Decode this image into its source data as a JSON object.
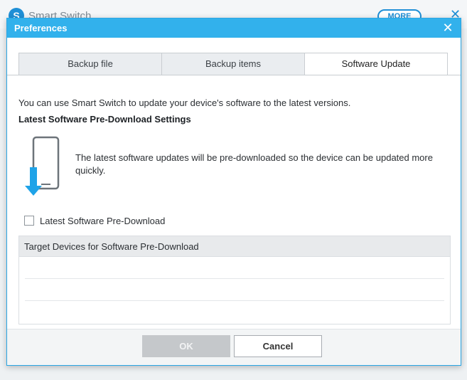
{
  "background_app": {
    "title": "Smart Switch",
    "more_label": "MORE",
    "close_glyph": "✕",
    "logo_glyph": "S"
  },
  "dialog": {
    "title": "Preferences",
    "close_glyph": "✕"
  },
  "tabs": [
    {
      "label": "Backup file",
      "active": false
    },
    {
      "label": "Backup items",
      "active": false
    },
    {
      "label": "Software Update",
      "active": true
    }
  ],
  "content": {
    "description": "You can use Smart Switch to update your device's software to the latest versions.",
    "section_heading": "Latest Software Pre-Download Settings",
    "info_text": "The latest software updates will be pre-downloaded so the device can be updated more quickly.",
    "checkbox": {
      "label": "Latest Software Pre-Download",
      "checked": false
    },
    "target_table": {
      "header": "Target Devices for Software Pre-Download",
      "rows": [
        "",
        "",
        ""
      ]
    }
  },
  "footer": {
    "ok_label": "OK",
    "ok_enabled": false,
    "cancel_label": "Cancel"
  },
  "icons": {
    "phone": "phone-download-icon"
  },
  "colors": {
    "header_blue": "#32b1ec",
    "arrow_blue": "#1fa3e8",
    "brand_blue": "#1f8fd6"
  }
}
